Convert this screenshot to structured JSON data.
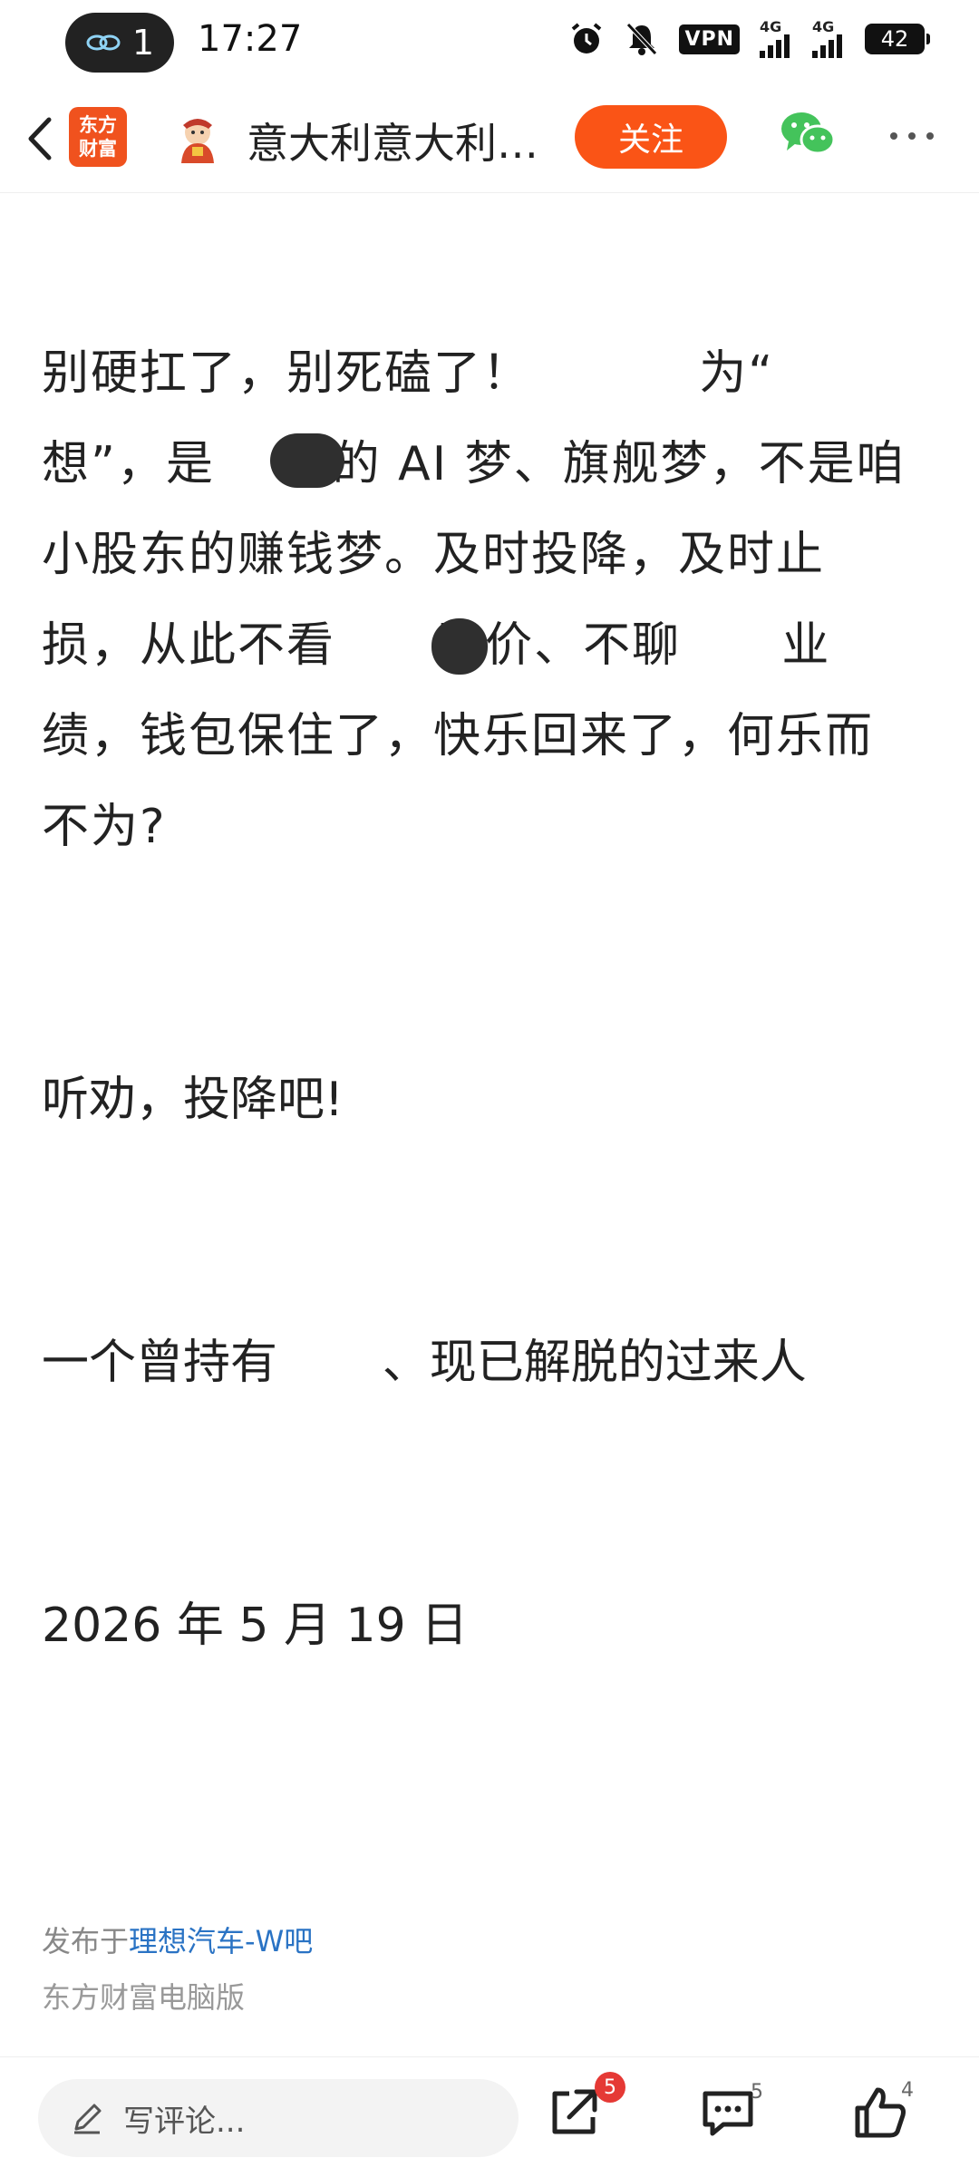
{
  "status_bar": {
    "notification_count": "1",
    "time": "17:27",
    "vpn_label": "VPN",
    "signal1_label": "4G",
    "signal2_label": "4G",
    "battery_level": "42"
  },
  "header": {
    "app_logo_line1": "东方",
    "app_logo_line2": "财富",
    "username": "意大利意大利…",
    "follow_label": "关注"
  },
  "article": {
    "paragraph1_lines": [
      "别硬扛了，别死磕了！          为“    ",
      "想”，是       的 AI 梦、旗舰梦，不是咱",
      "小股东的赚钱梦。及时投降，及时止",
      "损，从此不看      股价、不聊      业",
      "绩，钱包保住了，快乐回来了，何乐而",
      "不为?"
    ],
    "paragraph2": "听劝，投降吧!",
    "paragraph3": "一个曾持有       、现已解脱的过来人",
    "date_line": "2026 年 5 月 19 日"
  },
  "meta": {
    "published_prefix": "发布于",
    "published_forum": "理想汽车-W吧",
    "source": "东方财富电脑版"
  },
  "bottom_bar": {
    "comment_placeholder": "写评论...",
    "share_badge": "5",
    "comment_count": "5",
    "like_count": "4"
  },
  "colors": {
    "accent_orange": "#fa5416",
    "link_blue": "#2a73c4",
    "badge_red": "#e53935"
  }
}
